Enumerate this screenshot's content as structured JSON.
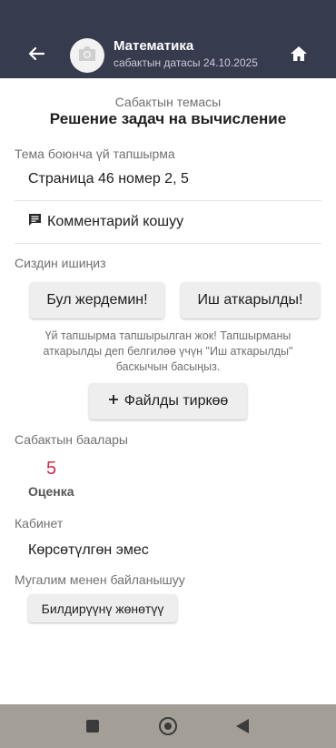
{
  "header": {
    "title": "Математика",
    "subtitle": "сабактын датасы 24.10.2025",
    "back_icon": "arrow-left-icon",
    "avatar_icon": "camera-icon",
    "home_icon": "home-icon",
    "bar_color": "#363b4e"
  },
  "topic": {
    "label": "Сабактын темасы",
    "title": "Решение задач на вычисление"
  },
  "homework": {
    "label": "Тема боюнча үй тапшырма",
    "text": "Страница 46 номер 2, 5"
  },
  "comment": {
    "icon": "comment-icon",
    "label": "Комментарий кошуу"
  },
  "your_work": {
    "label": "Сиздин ишиңиз",
    "help_button": "Бул жердемин!",
    "done_button": "Иш аткарылды!",
    "notice": "Үй тапшырма тапшырылган жок! Тапшырманы аткарылды деп белгилөө үчүн \"Иш аткарылды\" баскычын басыңыз.",
    "attach_icon": "plus-icon",
    "attach_button": "Файлды тиркөө"
  },
  "grades": {
    "label": "Сабактын баалары",
    "value": "5",
    "type": "Оценка",
    "value_color": "#c62d4a"
  },
  "cabinet": {
    "label": "Кабинет",
    "value": "Көрсөтүлгөн эмес"
  },
  "contact": {
    "label": "Мугалим менен байланышуу",
    "button": "Билдирүүнү жөнөтүү"
  },
  "system_nav": {
    "recents_icon": "square-icon",
    "home_icon": "circle-home-icon",
    "back_icon": "triangle-back-icon"
  }
}
